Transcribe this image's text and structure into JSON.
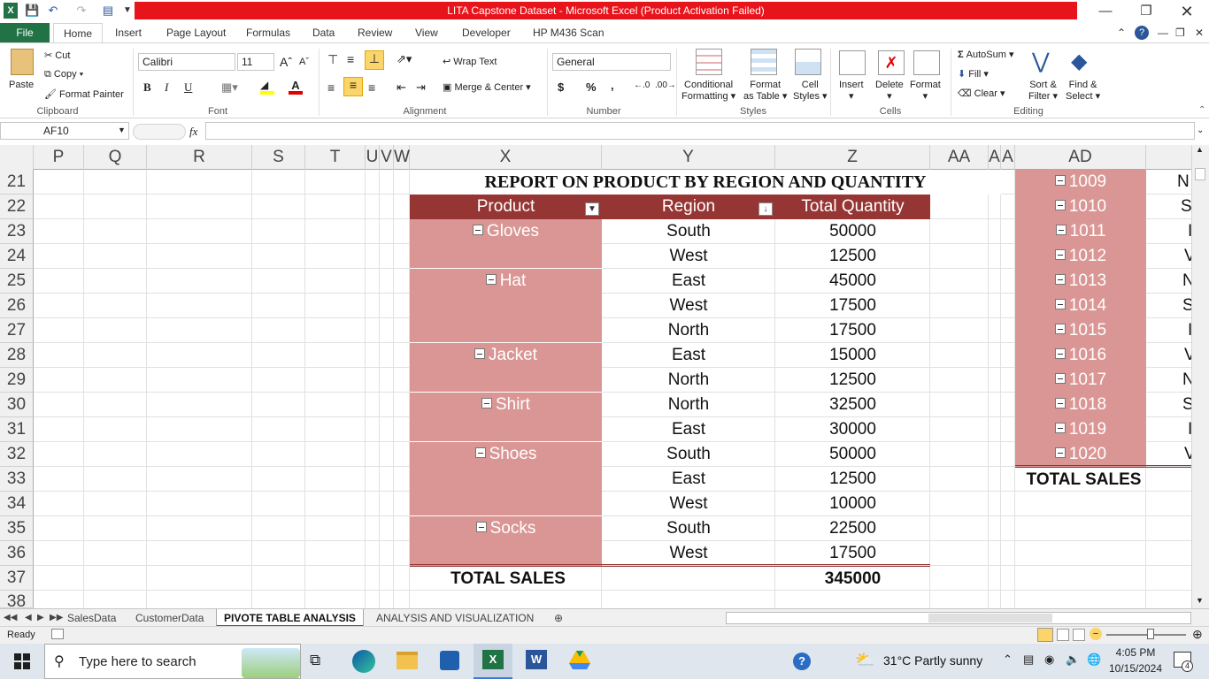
{
  "window": {
    "title": "LITA Capstone Dataset  -  Microsoft Excel (Product Activation Failed)"
  },
  "ribbon_tabs": [
    "File",
    "Home",
    "Insert",
    "Page Layout",
    "Formulas",
    "Data",
    "Review",
    "View",
    "Developer",
    "HP M436 Scan"
  ],
  "ribbon": {
    "clipboard": {
      "paste": "Paste",
      "cut": "Cut",
      "copy": "Copy",
      "format_painter": "Format Painter",
      "label": "Clipboard"
    },
    "font": {
      "name": "Calibri",
      "size": "11",
      "label": "Font",
      "bold": "B",
      "italic": "I",
      "underline": "U"
    },
    "alignment": {
      "wrap_text": "Wrap Text",
      "merge_center": "Merge & Center",
      "label": "Alignment"
    },
    "number": {
      "format": "General",
      "currency": "$",
      "percent": "%",
      "comma": ",",
      "label": "Number"
    },
    "styles": {
      "conditional": "Conditional",
      "conditional2": "Formatting",
      "format_as": "Format",
      "format_as2": "as Table",
      "cell": "Cell",
      "cell2": "Styles",
      "label": "Styles"
    },
    "cells": {
      "insert": "Insert",
      "delete": "Delete",
      "format": "Format",
      "label": "Cells"
    },
    "editing": {
      "autosum": "AutoSum",
      "fill": "Fill",
      "clear": "Clear",
      "sort": "Sort &",
      "sort2": "Filter",
      "find": "Find &",
      "find2": "Select",
      "label": "Editing"
    }
  },
  "formula_bar": {
    "name_box": "AF10",
    "fx": "fx",
    "value": ""
  },
  "columns": [
    "P",
    "Q",
    "R",
    "S",
    "T",
    "U",
    "V",
    "W",
    "X",
    "Y",
    "Z",
    "AA",
    "A",
    "A",
    "AD"
  ],
  "rows": [
    "21",
    "22",
    "23",
    "24",
    "25",
    "26",
    "27",
    "28",
    "29",
    "30",
    "31",
    "32",
    "33",
    "34",
    "35",
    "36",
    "37",
    "38"
  ],
  "report": {
    "title": "REPORT ON PRODUCT BY REGION AND QUANTITY",
    "headers": {
      "product": "Product",
      "region": "Region",
      "quantity": "Total Quantity"
    },
    "rows": [
      {
        "product": "Gloves",
        "region": "South",
        "qty": "50000"
      },
      {
        "product": "",
        "region": "West",
        "qty": "12500"
      },
      {
        "product": "Hat",
        "region": "East",
        "qty": "45000"
      },
      {
        "product": "",
        "region": "West",
        "qty": "17500"
      },
      {
        "product": "",
        "region": "North",
        "qty": "17500"
      },
      {
        "product": "Jacket",
        "region": "East",
        "qty": "15000"
      },
      {
        "product": "",
        "region": "North",
        "qty": "12500"
      },
      {
        "product": "Shirt",
        "region": "North",
        "qty": "32500"
      },
      {
        "product": "",
        "region": "East",
        "qty": "30000"
      },
      {
        "product": "Shoes",
        "region": "South",
        "qty": "50000"
      },
      {
        "product": "",
        "region": "East",
        "qty": "12500"
      },
      {
        "product": "",
        "region": "West",
        "qty": "10000"
      },
      {
        "product": "Socks",
        "region": "South",
        "qty": "22500"
      },
      {
        "product": "",
        "region": "West",
        "qty": "17500"
      }
    ],
    "total_label": "TOTAL SALES",
    "total_value": "345000"
  },
  "side_table": {
    "ids": [
      "1009",
      "1010",
      "1011",
      "1012",
      "1013",
      "1014",
      "1015",
      "1016",
      "1017",
      "1018",
      "1019",
      "1020"
    ],
    "next_col": [
      "N",
      "S",
      "I",
      "V",
      "N",
      "S",
      "I",
      "V",
      "N",
      "S",
      "I",
      "V"
    ],
    "total_label": "TOTAL SALES"
  },
  "sheet_tabs": [
    "SalesData",
    "CustomerData",
    "PIVOTE TABLE ANALYSIS",
    "ANALYSIS AND VISUALIZATION"
  ],
  "status": {
    "ready": "Ready"
  },
  "taskbar": {
    "search_placeholder": "Type here to search",
    "weather": "31°C  Partly sunny",
    "time": "4:05 PM",
    "date": "10/15/2024",
    "notifications": "4"
  },
  "colors": {
    "excel_green": "#217346",
    "title_red": "#e8141b",
    "header_dark_red": "#963634",
    "row_pink": "#da9694"
  }
}
